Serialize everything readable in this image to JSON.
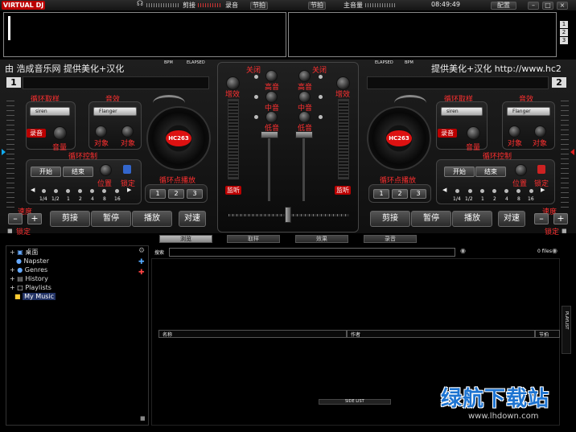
{
  "topbar": {
    "logo": "VIRTUAL DJ",
    "cut": "剪接",
    "rec": "录音",
    "beat": "节拍",
    "beat2": "节拍",
    "master": "主音量",
    "time": "08:49:49",
    "config": "配置"
  },
  "deck_numbers": [
    "1",
    "2",
    "3"
  ],
  "marquee": {
    "left": "由 浩成音乐网 提供美化+汉化",
    "right": "提供美化+汉化 http://www.hc2"
  },
  "deck_info": {
    "bpm": "BPM",
    "elapsed": "ELAPSED"
  },
  "mixer": {
    "off": "关闭",
    "treble": "高音",
    "mid": "中音",
    "bass": "低音",
    "gain": "增效",
    "gain_top": "增效",
    "monitor": "监听"
  },
  "deck": {
    "loop_sample": "循环取样",
    "effect": "音效",
    "sample_select": "siren",
    "effect_select": "Flanger",
    "rec": "录音",
    "vol": "音量",
    "obj": "对象",
    "obj2": "对象",
    "platter": "HC263",
    "loop_ctrl": "循环控制",
    "start": "开始",
    "end": "结束",
    "pos": "位置",
    "lock": "锁定",
    "loop_point": "循环点播放",
    "loop_sizes": [
      "1/4",
      "1/2",
      "1",
      "2",
      "4",
      "8",
      "16"
    ],
    "cues": [
      "1",
      "2",
      "3"
    ],
    "cut": "剪接",
    "pause": "暂停",
    "play": "播放",
    "sync": "对速",
    "speed": "速度",
    "speed_lock": "锁定"
  },
  "tabs": [
    "浏览",
    "取样",
    "效果",
    "录音"
  ],
  "browser": {
    "tree": [
      "桌面",
      "Napster",
      "Genres",
      "History",
      "Playlists",
      "My Music"
    ],
    "search_label": "搜索",
    "files": "0 files",
    "col_title": "名称",
    "col_artist": "作者",
    "col_bpm": "节拍",
    "side_list": "SIDE LIST",
    "playlist": "PLAYLIST"
  },
  "watermark": {
    "main": "绿航下载站",
    "url": "www.lhdown.com"
  }
}
